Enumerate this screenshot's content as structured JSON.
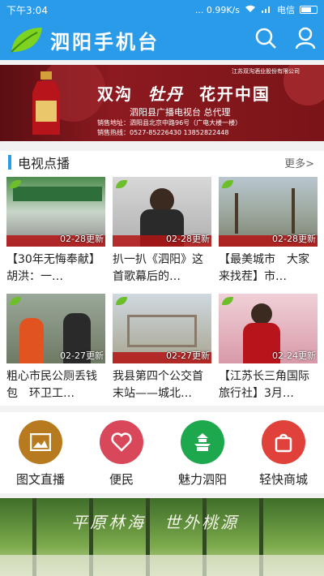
{
  "status": {
    "time": "下午3:04",
    "right": "... 0.99K/s",
    "carrier": "电信"
  },
  "app": {
    "title": "泗阳手机台"
  },
  "banner": {
    "brand": "江苏双沟酒业股份有限公司",
    "slogan_left": "双沟",
    "slogan_mid": "牡丹",
    "slogan_right": "花开中国",
    "agent": "泗阳县广播电视台 总代理",
    "address": "销售地址：泗阳县北京中路96号（广电大楼一楼）",
    "tel": "销售热线：0527-85226430 13852822448"
  },
  "tv": {
    "title": "电视点播",
    "more": "更多>",
    "items": [
      {
        "caption": "【30年无悔奉献】胡洪：一…",
        "date": "02-28更新"
      },
      {
        "caption": "扒一扒《泗阳》这首歌幕后的…",
        "date": "02-28更新"
      },
      {
        "caption": "【最美城市　大家来找茬】市…",
        "date": "02-28更新"
      },
      {
        "caption": "粗心市民公厕丢钱包　环卫工…",
        "date": "02-27更新"
      },
      {
        "caption": "我县第四个公交首末站——城北…",
        "date": "02-27更新"
      },
      {
        "caption": "【江苏长三角国际旅行社】3月…",
        "date": "02-24更新"
      }
    ]
  },
  "categories": [
    {
      "label": "图文直播",
      "color": "#b87a1e"
    },
    {
      "label": "便民",
      "color": "#d9475a"
    },
    {
      "label": "魅力泗阳",
      "color": "#1ea84e"
    },
    {
      "label": "轻快商城",
      "color": "#e0413a"
    }
  ],
  "bottom_banner": {
    "text": "平原林海　世外桃源"
  }
}
